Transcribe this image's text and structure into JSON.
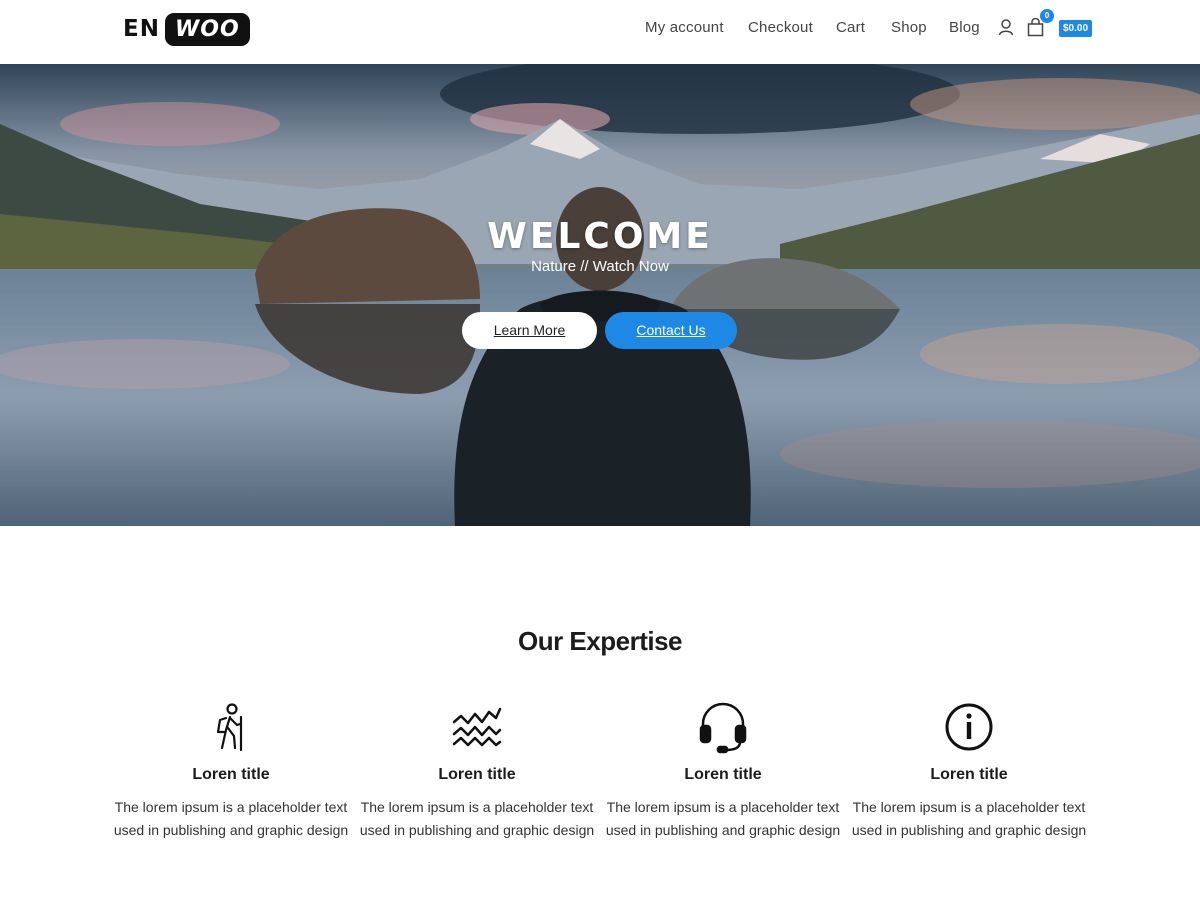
{
  "header": {
    "logo_left": "EN",
    "logo_right": "WOO",
    "nav": [
      "My account",
      "Checkout",
      "Cart",
      "Shop",
      "Blog"
    ],
    "account_icon": "user-icon",
    "cart_icon": "shopping-bag-icon",
    "cart_count": "0",
    "cart_total": "$0.00"
  },
  "hero": {
    "title": "WELCOME",
    "subtitle": "Nature // Watch Now",
    "primary_button": "Learn More",
    "secondary_button": "Contact Us"
  },
  "expertise": {
    "title": "Our Expertise",
    "items": [
      {
        "icon": "hiker-icon",
        "title": "Loren title",
        "line1": "The lorem ipsum is a placeholder text",
        "line2": "used in publishing and graphic design"
      },
      {
        "icon": "zigzag-waves-icon",
        "title": "Loren title",
        "line1": "The lorem ipsum is a placeholder text",
        "line2": "used in publishing and graphic design"
      },
      {
        "icon": "headset-icon",
        "title": "Loren title",
        "line1": "The lorem ipsum is a placeholder text",
        "line2": "used in publishing and graphic design"
      },
      {
        "icon": "info-icon",
        "title": "Loren title",
        "line1": "The lorem ipsum is a placeholder text",
        "line2": "used in publishing and graphic design"
      }
    ]
  },
  "colors": {
    "accent": "#1e88e5",
    "logo_dark": "#111111",
    "text": "#1c1c1c"
  }
}
